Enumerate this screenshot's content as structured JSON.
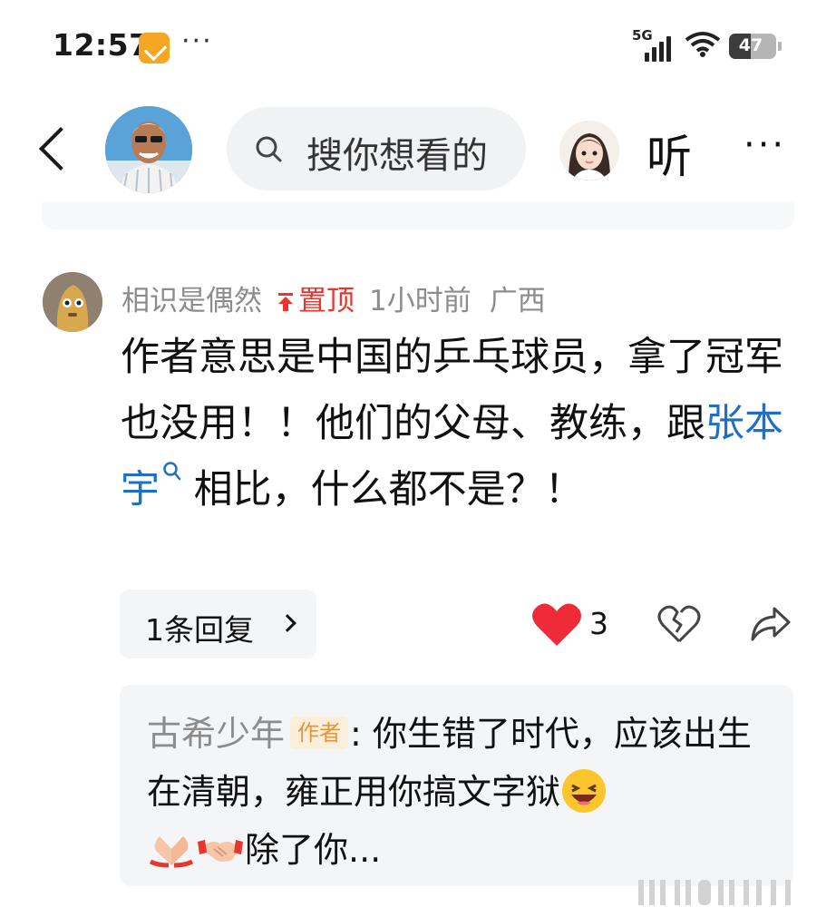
{
  "status_bar": {
    "time": "12:57",
    "dots": "···",
    "network": "5G",
    "battery": "47",
    "battery_level": 0.47
  },
  "nav": {
    "search_placeholder": "搜你想看的",
    "listen_label": "听",
    "more_label": "···"
  },
  "comment": {
    "user": "相识是偶然",
    "pinned_label": "置顶",
    "time": "1小时前",
    "location": "广西",
    "text_before": "作者意思是中国的乒乓球员，拿了冠军也没用！！他们的父母、教练，跟",
    "highlight": "张本宇",
    "text_after": " 相比，什么都不是？！",
    "reply_count_label": "1条回复",
    "like_count": "3"
  },
  "reply": {
    "user": "古希少年",
    "author_tag": "作者",
    "text_part1": ": 你生错了时代，应该出生在清朝，雍正用你搞文字狱",
    "text_part2": "除了你..."
  },
  "colors": {
    "accent_red": "#e8362c",
    "link_blue": "#1f6fc8",
    "author_tag": "#e3963d"
  }
}
